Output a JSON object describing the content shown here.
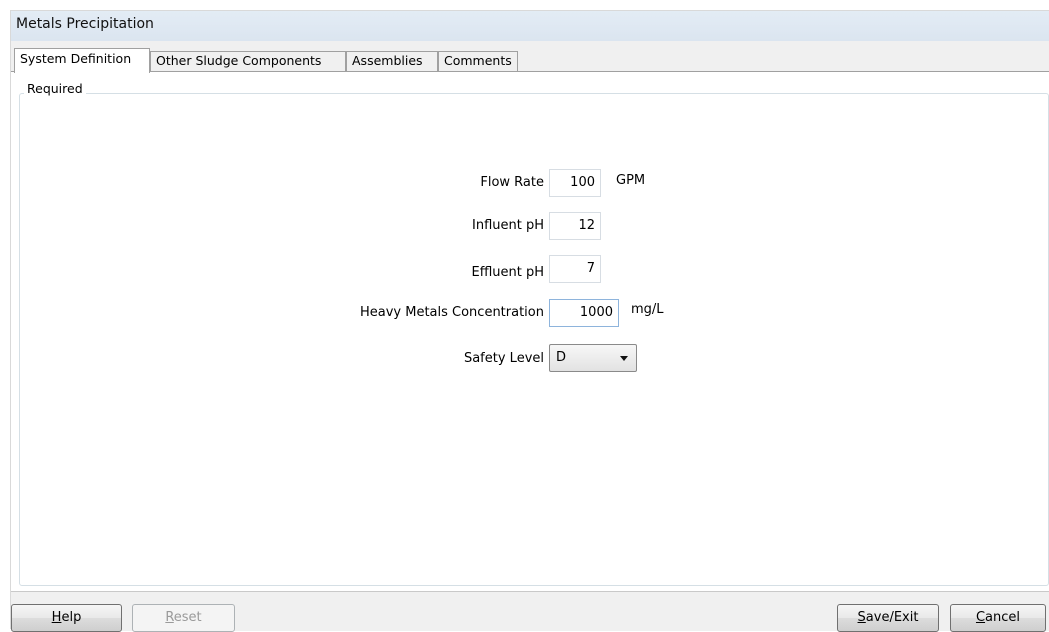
{
  "window": {
    "title": "Metals Precipitation"
  },
  "tabs": [
    {
      "label": "System Definition",
      "active": true
    },
    {
      "label": "Other Sludge Components",
      "active": false
    },
    {
      "label": "Assemblies",
      "active": false
    },
    {
      "label": "Comments",
      "active": false
    }
  ],
  "group": {
    "legend": "Required"
  },
  "form": {
    "flow_rate": {
      "label": "Flow Rate",
      "value": "100",
      "unit": "GPM"
    },
    "influent_ph": {
      "label": "Influent pH",
      "value": "12"
    },
    "effluent_ph": {
      "label": "Effluent pH",
      "value": "7"
    },
    "heavy_metals": {
      "label": "Heavy Metals Concentration",
      "value": "1000",
      "unit": "mg/L"
    },
    "safety_level": {
      "label": "Safety Level",
      "value": "D"
    }
  },
  "buttons": {
    "help": {
      "accel": "H",
      "rest": "elp"
    },
    "reset": {
      "accel": "R",
      "rest": "eset",
      "enabled": false
    },
    "save_exit": {
      "accel": "S",
      "rest": "ave/Exit"
    },
    "cancel": {
      "accel": "C",
      "rest": "ancel"
    }
  }
}
